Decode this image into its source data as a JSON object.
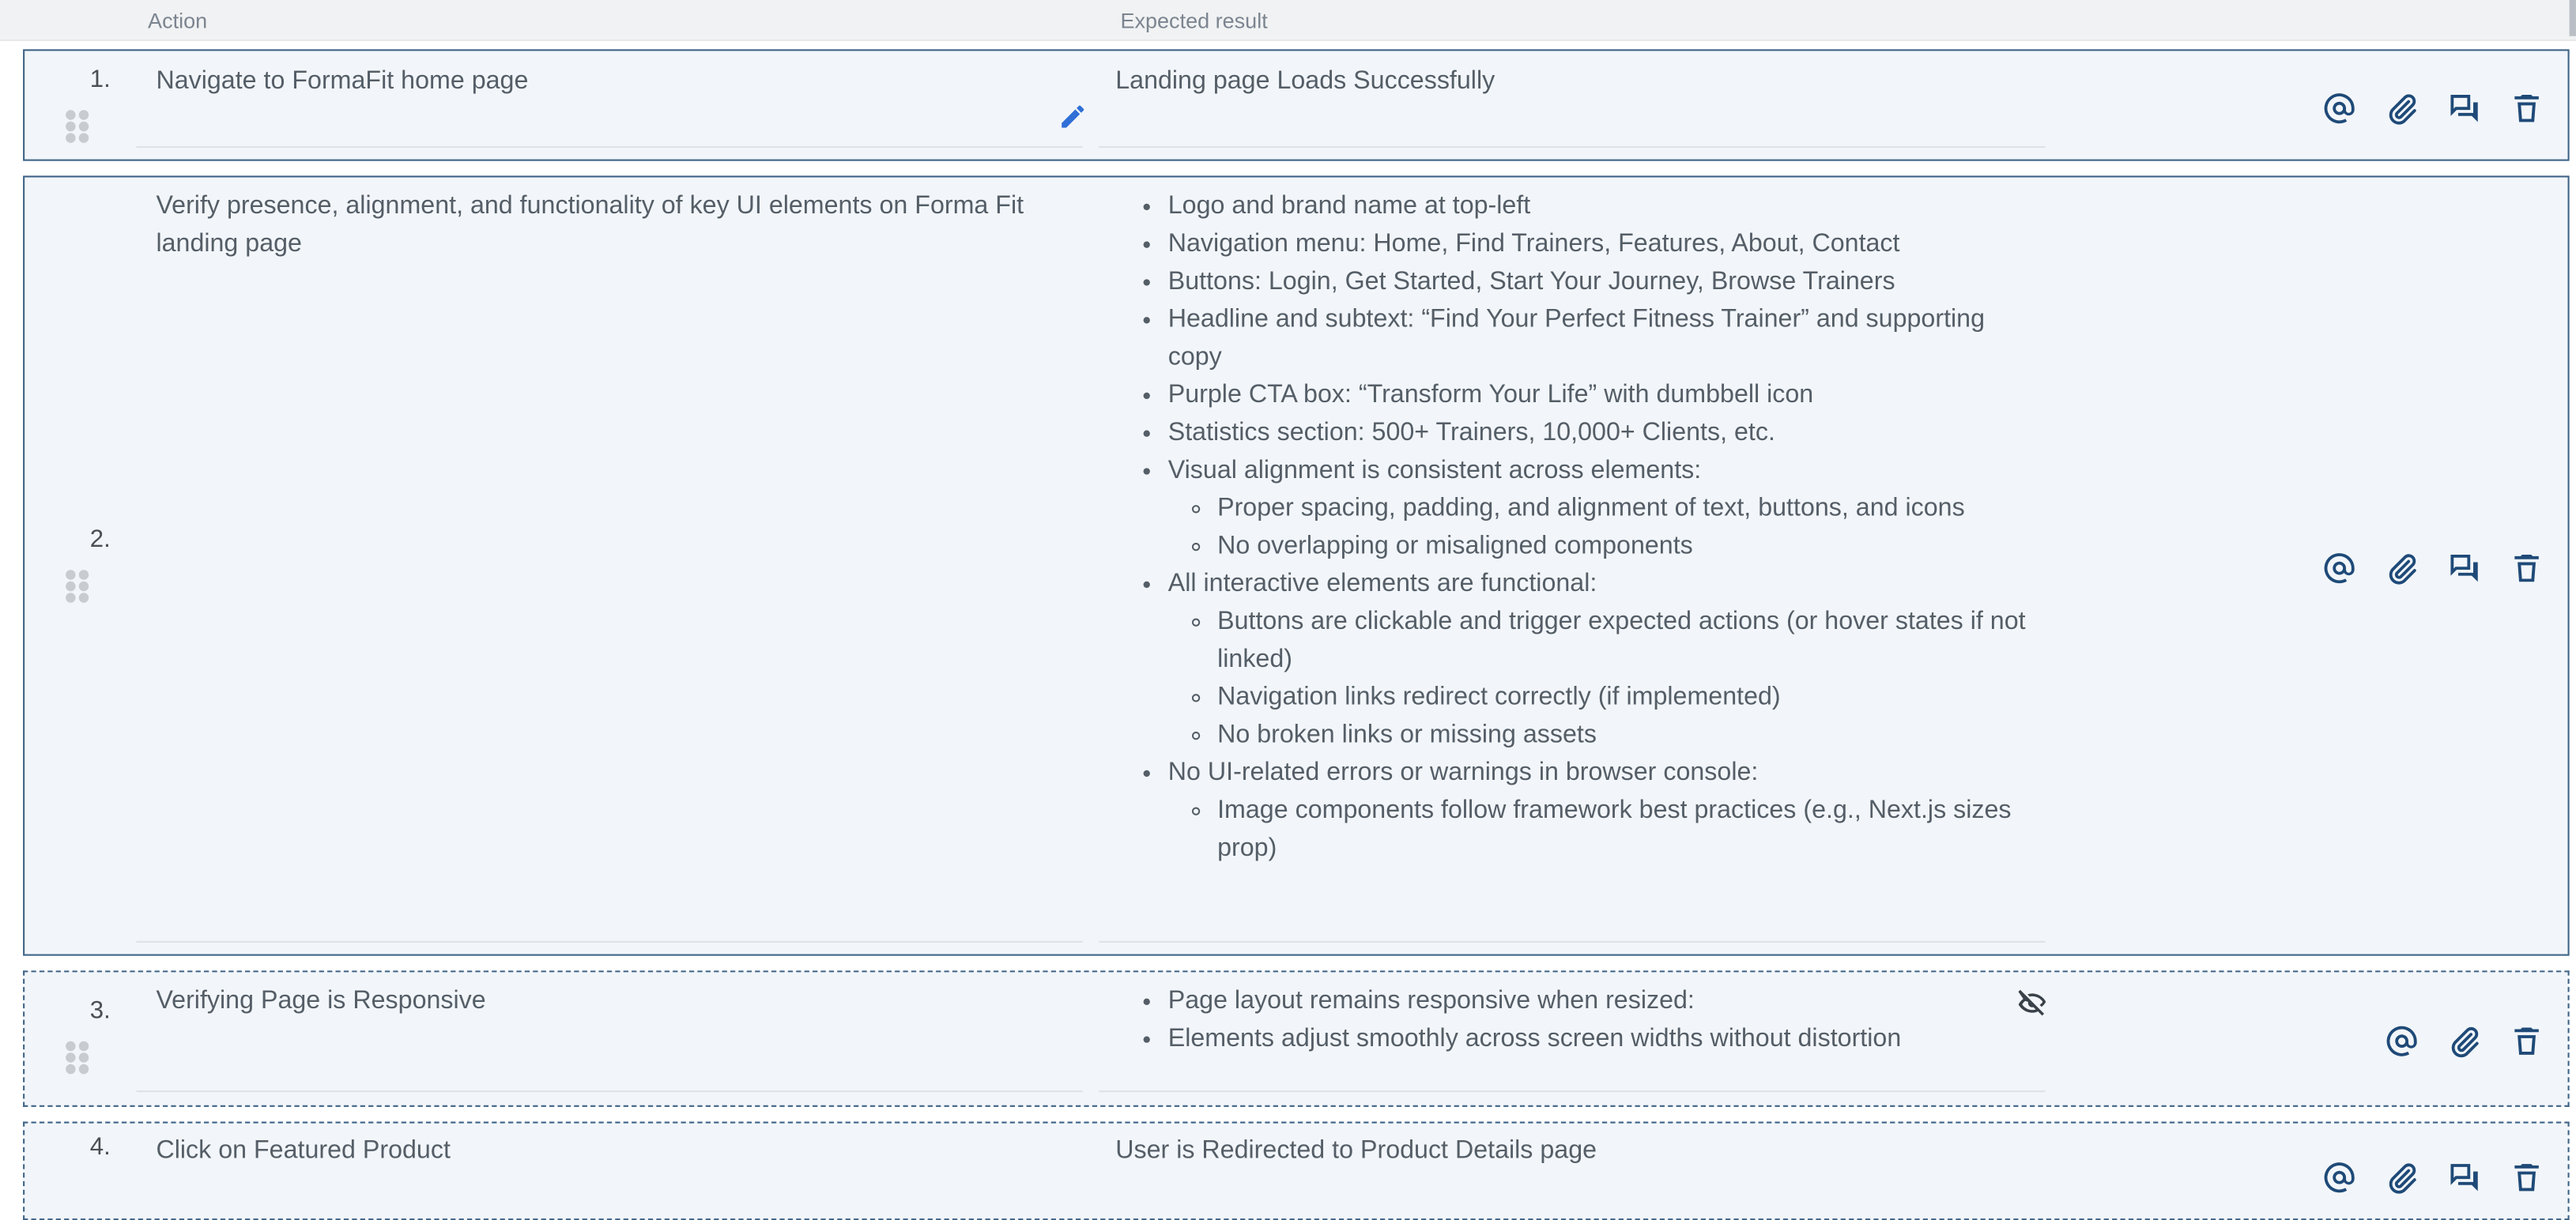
{
  "header": {
    "action_label": "Action",
    "expected_label": "Expected result"
  },
  "steps": [
    {
      "number": "1.",
      "action": "Navigate to FormaFit home page",
      "expected_text": "Landing page Loads Successfully"
    },
    {
      "number": "2.",
      "action": "Verify presence, alignment, and functionality of key UI elements on Forma Fit landing page",
      "expected_list": [
        "Logo and brand name at top-left",
        "Navigation menu: Home, Find Trainers, Features, About, Contact",
        "Buttons: Login, Get Started, Start Your Journey, Browse Trainers",
        "Headline and subtext: “Find Your Perfect Fitness Trainer” and supporting copy",
        "Purple CTA box: “Transform Your Life” with dumbbell icon",
        "Statistics section: 500+ Trainers, 10,000+ Clients, etc.",
        "Visual alignment is consistent across elements:",
        "Proper spacing, padding, and alignment of text, buttons, and icons",
        "No overlapping or misaligned components",
        "All interactive elements are functional:",
        "Buttons are clickable and trigger expected actions (or hover states if not linked)",
        "Navigation links redirect correctly (if implemented)",
        "No broken links or missing assets",
        "No UI-related errors or warnings in browser console:",
        "Image components follow framework best practices (e.g., Next.js sizes prop)"
      ]
    },
    {
      "number": "3.",
      "action": "Verifying Page is Responsive",
      "expected_list": [
        "Page layout remains responsive when resized:",
        "Elements adjust smoothly across screen widths without distortion"
      ]
    },
    {
      "number": "4.",
      "action": "Click on Featured Product",
      "expected_text": "User is Redirected to Product Details page"
    }
  ],
  "icons": {
    "mention": "at-icon",
    "attach": "paperclip-icon",
    "comment": "comment-icon",
    "delete": "trash-icon",
    "edit": "pencil-icon",
    "hidden": "eye-off-icon",
    "drag": "drag-handle-icon"
  },
  "colors": {
    "border": "#3e6386",
    "row_bg": "#f2f6fa",
    "icon": "#1f4a78",
    "edit": "#2f6fd6"
  }
}
